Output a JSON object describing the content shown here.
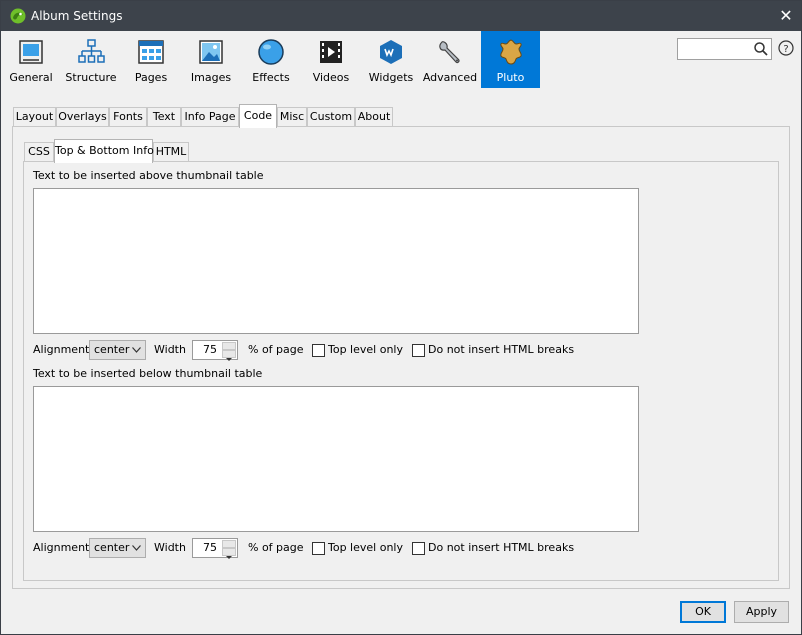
{
  "window": {
    "title": "Album Settings",
    "close_glyph": "✕"
  },
  "toolbar": {
    "items": [
      {
        "label": "General",
        "icon": "general-icon"
      },
      {
        "label": "Structure",
        "icon": "structure-icon"
      },
      {
        "label": "Pages",
        "icon": "pages-icon"
      },
      {
        "label": "Images",
        "icon": "images-icon"
      },
      {
        "label": "Effects",
        "icon": "effects-icon"
      },
      {
        "label": "Videos",
        "icon": "videos-icon"
      },
      {
        "label": "Widgets",
        "icon": "widgets-icon"
      },
      {
        "label": "Advanced",
        "icon": "advanced-icon"
      },
      {
        "label": "Pluto",
        "icon": "pluto-icon"
      }
    ],
    "active": "Pluto",
    "accent_color": "#0078d7"
  },
  "search": {
    "value": "",
    "placeholder": ""
  },
  "main_tabs": [
    "Layout",
    "Overlays",
    "Fonts",
    "Text",
    "Info Page",
    "Code",
    "Misc",
    "Custom",
    "About"
  ],
  "main_tab_active": "Code",
  "sub_tabs": [
    "CSS",
    "Top & Bottom Info",
    "HTML"
  ],
  "sub_tab_active": "Top & Bottom Info",
  "above": {
    "heading": "Text to be inserted above thumbnail table",
    "text": "",
    "alignment_label": "Alignment",
    "alignment_value": "center",
    "width_label": "Width",
    "width_value": "75",
    "percent_label": "% of page",
    "top_level_label": "Top level only",
    "top_level_checked": false,
    "no_breaks_label": "Do not insert HTML breaks",
    "no_breaks_checked": false
  },
  "below": {
    "heading": "Text to be inserted below thumbnail table",
    "text": "",
    "alignment_label": "Alignment",
    "alignment_value": "center",
    "width_label": "Width",
    "width_value": "75",
    "percent_label": "% of page",
    "top_level_label": "Top level only",
    "top_level_checked": false,
    "no_breaks_label": "Do not insert HTML breaks",
    "no_breaks_checked": false
  },
  "footer": {
    "ok_label": "OK",
    "apply_label": "Apply"
  }
}
